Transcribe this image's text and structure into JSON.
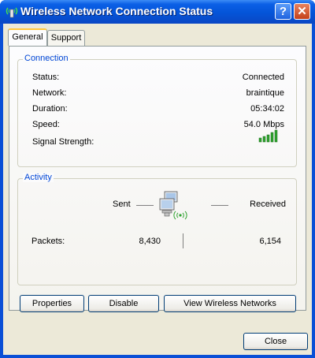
{
  "window": {
    "title": "Wireless Network Connection Status"
  },
  "titlebar": {
    "help_glyph": "?",
    "close_glyph": "✕"
  },
  "tabs": [
    {
      "label": "General"
    },
    {
      "label": "Support"
    }
  ],
  "connection": {
    "group_label": "Connection",
    "rows": [
      {
        "label": "Status:",
        "value": "Connected"
      },
      {
        "label": "Network:",
        "value": "braintique"
      },
      {
        "label": "Duration:",
        "value": "05:34:02"
      },
      {
        "label": "Speed:",
        "value": "54.0 Mbps"
      },
      {
        "label": "Signal Strength:",
        "value": ""
      }
    ],
    "signal_bars": 5
  },
  "activity": {
    "group_label": "Activity",
    "sent_label": "Sent",
    "received_label": "Received",
    "packets_label": "Packets:",
    "packets_sent": "8,430",
    "packets_received": "6,154"
  },
  "buttons": {
    "properties": "Properties",
    "disable": "Disable",
    "view_wireless": "View Wireless Networks",
    "close": "Close"
  },
  "colors": {
    "group_label": "#0046d5",
    "signal_green": "#2fa32f"
  }
}
